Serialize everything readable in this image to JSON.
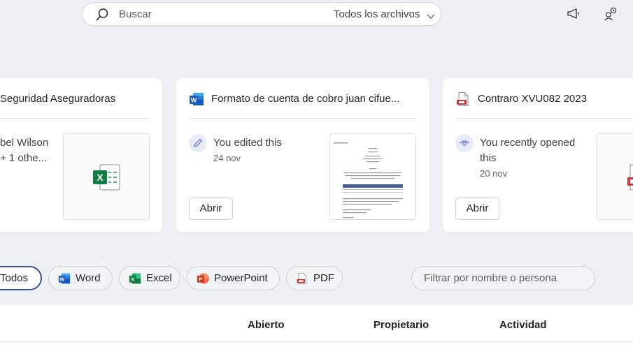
{
  "search": {
    "placeholder": "Buscar",
    "scope": "Todos los archivos"
  },
  "header_icons": [
    "megaphone-icon",
    "people-settings-icon"
  ],
  "cards": [
    {
      "title": "Seguridad Aseguradoras",
      "file_type": "excel",
      "owner_line1": "bel Wilson",
      "owner_line2": "+ 1 othe..."
    },
    {
      "title": "Formato de cuenta de cobro juan cifue...",
      "file_type": "word",
      "activity": "You edited this",
      "date": "24 nov",
      "open_label": "Abrir"
    },
    {
      "title": "Contraro XVU082 2023",
      "file_type": "pdf",
      "activity_line1": "You recently opened",
      "activity_line2": "this",
      "date": "20 nov",
      "open_label": "Abrir"
    }
  ],
  "filters": {
    "chips": [
      {
        "label": "Todos",
        "active": true
      },
      {
        "label": "Word",
        "icon": "word-icon"
      },
      {
        "label": "Excel",
        "icon": "excel-icon"
      },
      {
        "label": "PowerPoint",
        "icon": "powerpoint-icon"
      },
      {
        "label": "PDF",
        "icon": "pdf-icon"
      }
    ],
    "name_filter_placeholder": "Filtrar por nombre o persona"
  },
  "table": {
    "columns": [
      "Abierto",
      "Propietario",
      "Actividad"
    ]
  },
  "colors": {
    "background": "#eef0f6",
    "accent": "#3b4fa0",
    "word": "#185abd",
    "excel": "#107c41",
    "powerpoint": "#c43e1c",
    "pdf": "#d13438"
  }
}
